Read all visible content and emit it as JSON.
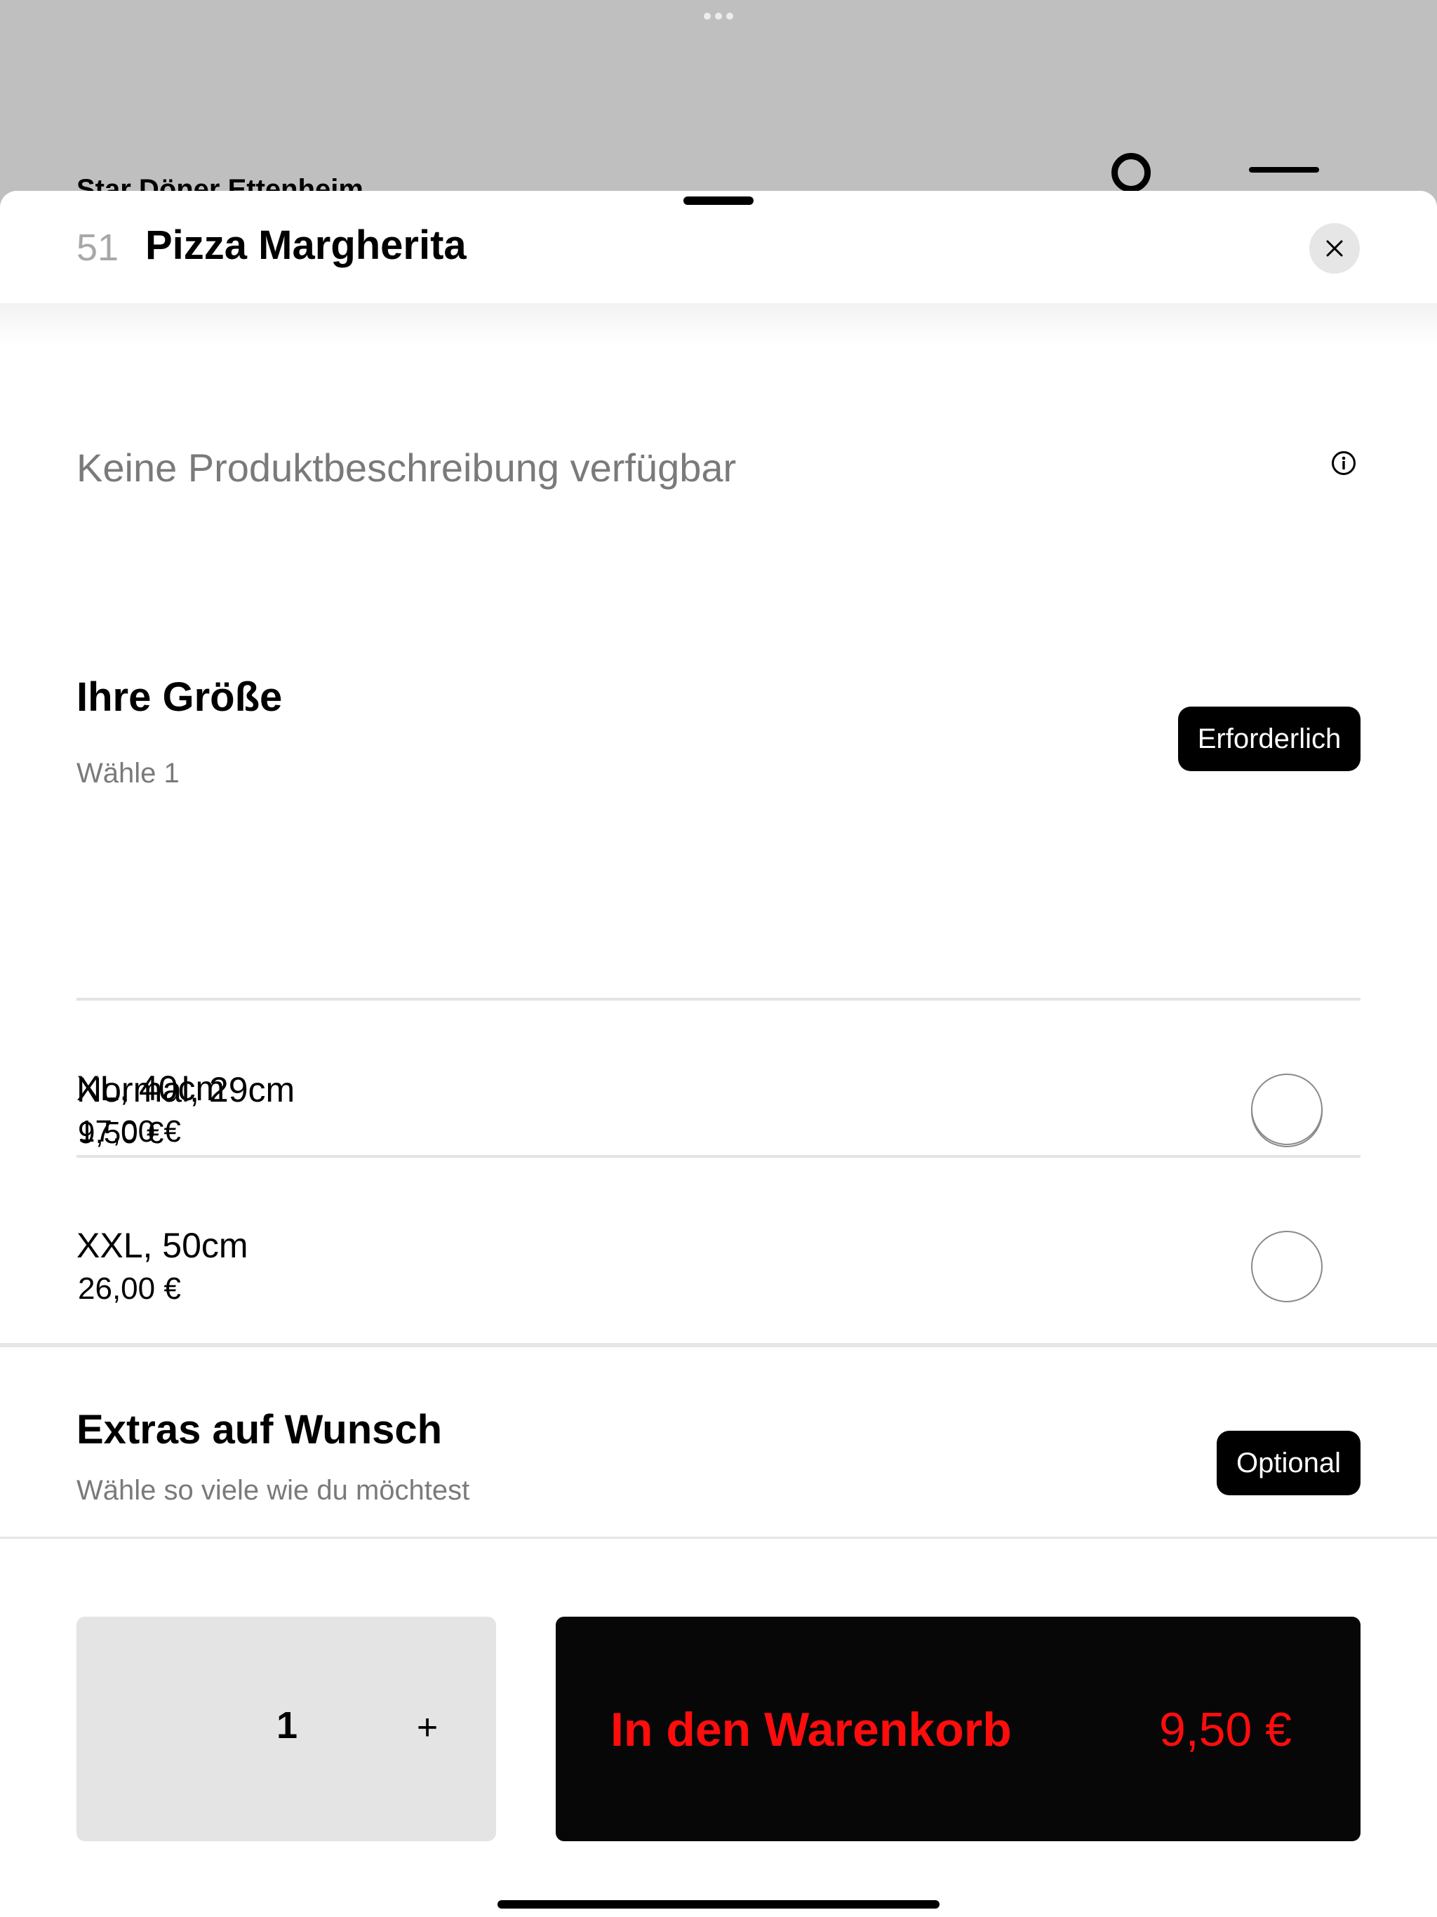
{
  "background_app": {
    "store_name": "Star Döner Ettenheim"
  },
  "product": {
    "number": "51",
    "title": "Pizza Margherita",
    "description": "Keine Produktbeschreibung verfügbar"
  },
  "size_group": {
    "title": "Ihre Größe",
    "subtitle": "Wähle 1",
    "badge": "Erforderlich",
    "options": [
      {
        "label": "Normal, 29cm",
        "price": "9,50 €",
        "selected": true
      },
      {
        "label": "XL, 40cm",
        "price": "17,00 €",
        "selected": false
      },
      {
        "label": "XXL, 50cm",
        "price": "26,00 €",
        "selected": false
      }
    ]
  },
  "extras_group": {
    "title": "Extras auf Wunsch",
    "subtitle": "Wähle so viele wie du möchtest",
    "badge": "Optional"
  },
  "footer": {
    "quantity": "1",
    "plus_label": "+",
    "cart_label": "In den Warenkorb",
    "cart_price": "9,50 €"
  },
  "icons": {
    "close": "close-icon",
    "info": "info-icon",
    "search": "search-icon",
    "menu": "menu-icon"
  },
  "colors": {
    "cart_text": "#ff0d0d",
    "cart_background": "#070707",
    "badge_background": "#000000",
    "backdrop": "#bfbfbf"
  }
}
